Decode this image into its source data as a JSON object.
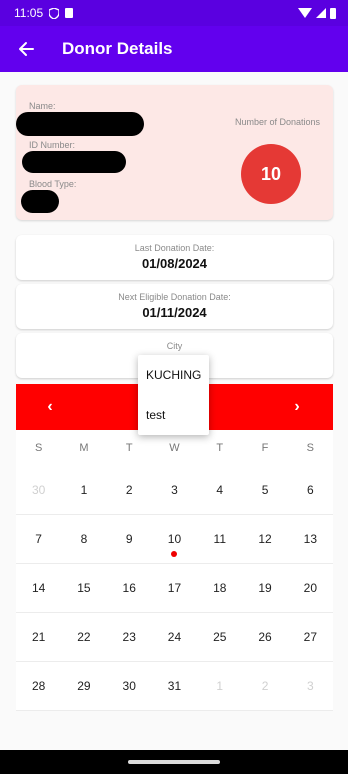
{
  "status_bar": {
    "time": "11:05"
  },
  "app_bar": {
    "title": "Donor Details",
    "back_icon": "arrow-left-icon"
  },
  "donor": {
    "name_label": "Name:",
    "id_label": "ID Number:",
    "blood_type_label": "Blood Type:",
    "donations_label": "Number of Donations",
    "donations_count": "10"
  },
  "last_donation": {
    "label": "Last Donation Date:",
    "value": "01/08/2024"
  },
  "next_eligible": {
    "label": "Next Eligible Donation Date:",
    "value": "01/11/2024"
  },
  "city": {
    "label": "City",
    "options": [
      "KUCHING",
      "test"
    ]
  },
  "calendar": {
    "prev": "‹",
    "next": "›",
    "weekdays": [
      "S",
      "M",
      "T",
      "W",
      "T",
      "F",
      "S"
    ],
    "weeks": [
      [
        "30",
        "1",
        "2",
        "3",
        "4",
        "5",
        "6"
      ],
      [
        "7",
        "8",
        "9",
        "10",
        "11",
        "12",
        "13"
      ],
      [
        "14",
        "15",
        "16",
        "17",
        "18",
        "19",
        "20"
      ],
      [
        "21",
        "22",
        "23",
        "24",
        "25",
        "26",
        "27"
      ],
      [
        "28",
        "29",
        "30",
        "31",
        "1",
        "2",
        "3"
      ]
    ]
  },
  "colors": {
    "app_bar": "#6200ee",
    "status_bar": "#5a00e0",
    "badge": "#e53935",
    "calendar_header": "#ff0000",
    "card_bg": "#fde8e6"
  }
}
